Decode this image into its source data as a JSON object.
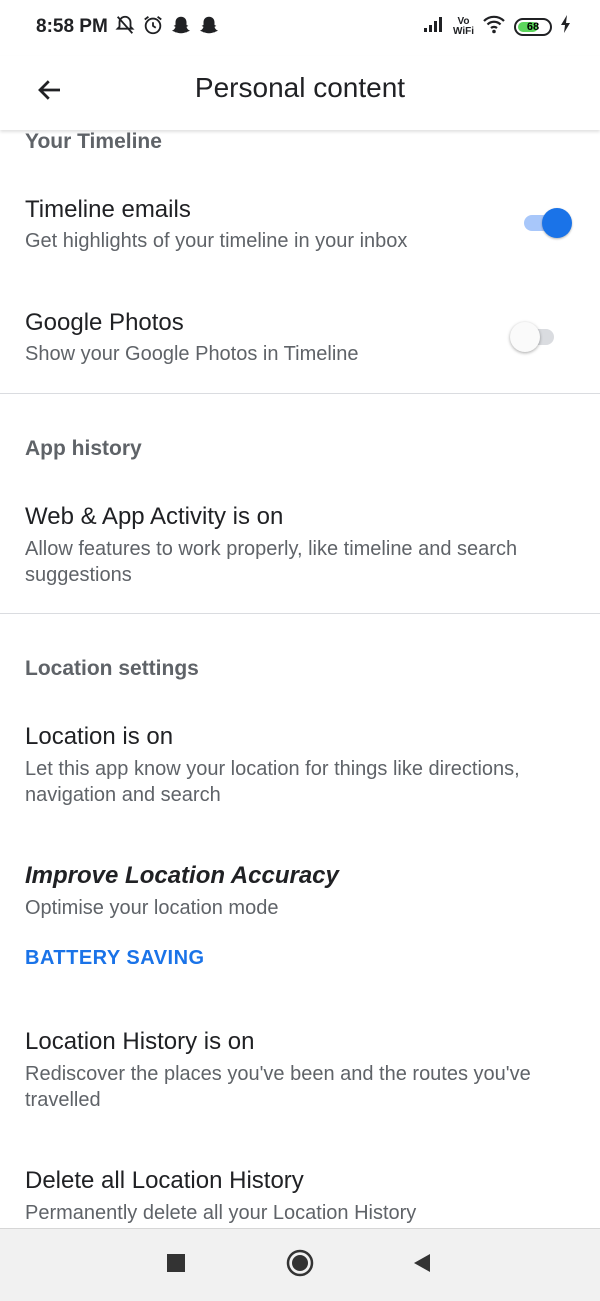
{
  "status_bar": {
    "time": "8:58 PM",
    "left_icons": [
      "mute-icon",
      "alarm-icon",
      "snapchat-icon",
      "snapchat-icon"
    ],
    "volte_top": "Vo",
    "volte_bottom": "WiFi",
    "battery_level": "68",
    "battery_color": "#5cd65c"
  },
  "app_bar": {
    "back_icon": "arrow-back-icon",
    "title": "Personal content"
  },
  "sections": {
    "timeline": {
      "header": "Your Timeline",
      "emails_title": "Timeline emails",
      "emails_sub": "Get highlights of your timeline in your inbox",
      "emails_on": true,
      "photos_title": "Google Photos",
      "photos_sub": "Show your Google Photos in Timeline",
      "photos_on": false
    },
    "app_history": {
      "header": "App history",
      "web_title": "Web & App Activity is on",
      "web_sub": "Allow features to work properly, like timeline and search suggestions"
    },
    "location": {
      "header": "Location settings",
      "location_title": "Location is on",
      "location_sub": "Let this app know your location for things like directions, navigation and search",
      "accuracy_title": "Improve Location Accuracy",
      "accuracy_sub": "Optimise your location mode",
      "accuracy_action": "BATTERY SAVING",
      "history_title": "Location History is on",
      "history_sub": "Rediscover the places you've been and the routes you've travelled",
      "delete_title": "Delete all Location History",
      "delete_sub": "Permanently delete all your Location History"
    }
  },
  "accent_color": "#1a73e8",
  "nav_bar": {
    "buttons": [
      "recents-square-icon",
      "home-circle-icon",
      "back-triangle-icon"
    ]
  }
}
